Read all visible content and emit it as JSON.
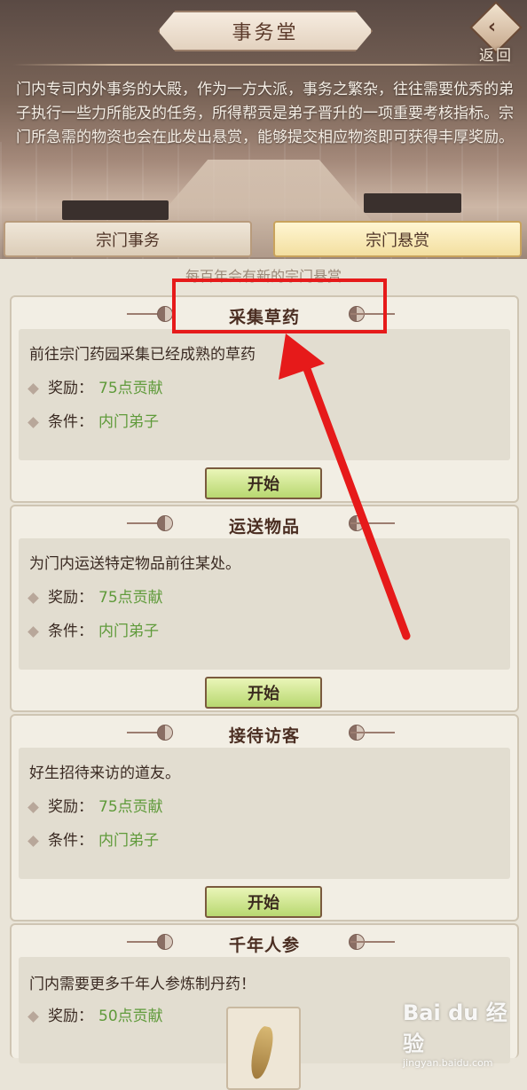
{
  "header": {
    "title": "事务堂",
    "back_label": "返回",
    "description": "门内专司内外事务的大殿，作为一方大派，事务之繁杂，往往需要优秀的弟子执行一些力所能及的任务，所得帮贡是弟子晋升的一项重要考核指标。宗门所急需的物资也会在此发出悬赏，能够提交相应物资即可获得丰厚奖励。"
  },
  "tabs": [
    {
      "label": "宗门事务",
      "active": false
    },
    {
      "label": "宗门悬赏",
      "active": true
    }
  ],
  "notice": "每百年会有新的宗门悬赏",
  "tasks": [
    {
      "title": "采集草药",
      "desc": "前往宗门药园采集已经成熟的草药",
      "reward_label": "奖励：",
      "reward_value": "75点贡献",
      "cond_label": "条件：",
      "cond_value": "内门弟子",
      "button": "开始"
    },
    {
      "title": "运送物品",
      "desc": "为门内运送特定物品前往某处。",
      "reward_label": "奖励：",
      "reward_value": "75点贡献",
      "cond_label": "条件：",
      "cond_value": "内门弟子",
      "button": "开始"
    },
    {
      "title": "接待访客",
      "desc": "好生招待来访的道友。",
      "reward_label": "奖励：",
      "reward_value": "75点贡献",
      "cond_label": "条件：",
      "cond_value": "内门弟子",
      "button": "开始"
    },
    {
      "title": "千年人参",
      "desc": "门内需要更多千年人参炼制丹药！",
      "reward_label": "奖励：",
      "reward_value": "50点贡献"
    }
  ],
  "watermark": {
    "brand": "Bai du 经验",
    "url": "jingyan.baidu.com"
  },
  "colors": {
    "highlight": "#e61a1a",
    "reward_text": "#5f9a3a"
  }
}
